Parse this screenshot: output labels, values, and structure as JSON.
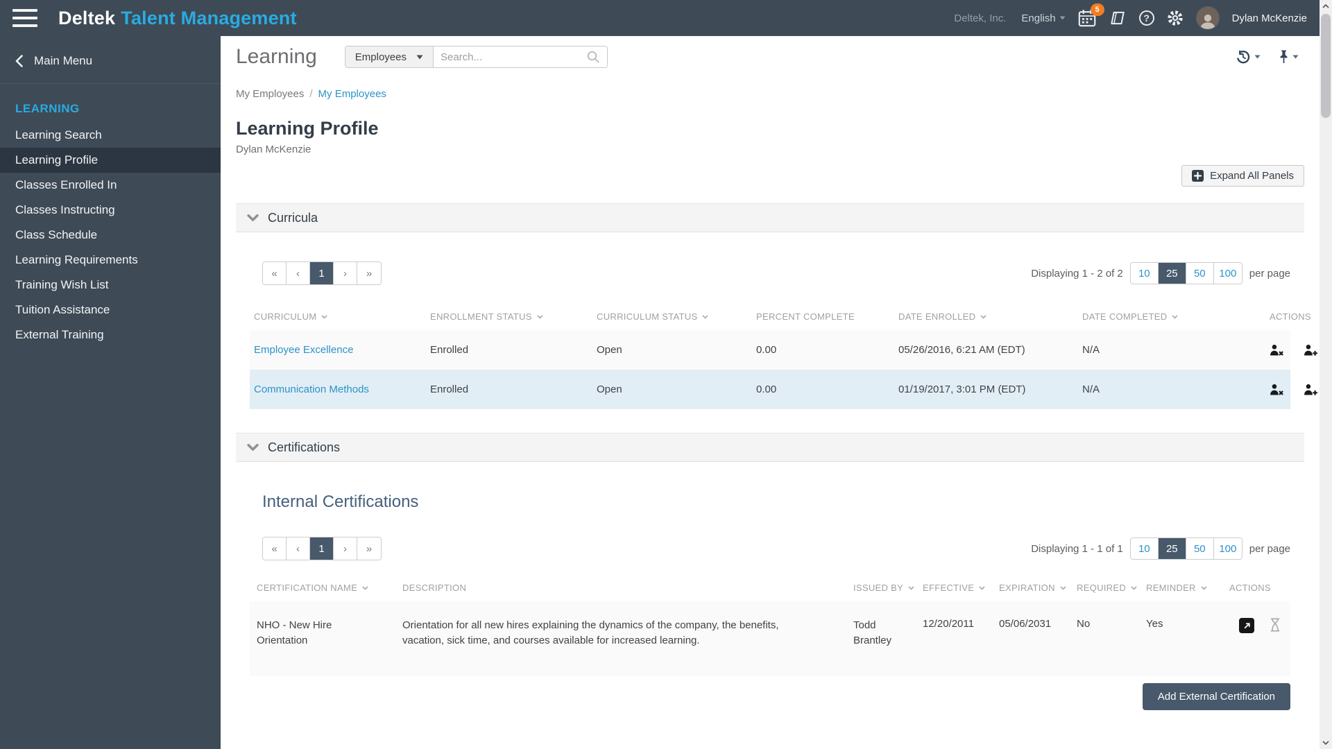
{
  "theme": {
    "topbar_bg": "#3e4a56",
    "accent_cyan": "#29abe2",
    "link_blue": "#2b93c8",
    "active_page_bg": "#47596b",
    "row_highlight": "#e2eef5",
    "badge_orange": "#f47c20"
  },
  "header": {
    "brand_deltek": "Deltek",
    "brand_product": "Talent Management",
    "company": "Deltek, Inc.",
    "language": "English",
    "notification_count": "5",
    "help_glyph": "?",
    "user_name": "Dylan McKenzie"
  },
  "sidebar": {
    "back_label": "Main Menu",
    "section": "LEARNING",
    "items": [
      {
        "label": "Learning Search"
      },
      {
        "label": "Learning Profile"
      },
      {
        "label": "Classes Enrolled In"
      },
      {
        "label": "Classes Instructing"
      },
      {
        "label": "Class Schedule"
      },
      {
        "label": "Learning Requirements"
      },
      {
        "label": "Training Wish List"
      },
      {
        "label": "Tuition Assistance"
      },
      {
        "label": "External Training"
      }
    ]
  },
  "page": {
    "module_title": "Learning",
    "search_scope": "Employees",
    "search_placeholder": "Search...",
    "breadcrumb": [
      "My Employees",
      "My Employees"
    ],
    "breadcrumb_separator": "/",
    "title": "Learning Profile",
    "subtitle": "Dylan McKenzie",
    "expand_all_label": "Expand All Panels"
  },
  "curricula": {
    "panel_title": "Curricula",
    "pagination": {
      "first": "«",
      "prev": "‹",
      "page": "1",
      "next": "›",
      "last": "»",
      "displaying": "Displaying 1 - 2 of 2",
      "sizes": [
        "10",
        "25",
        "50",
        "100"
      ],
      "active_size": "25",
      "per_page": "per page"
    },
    "columns": [
      "CURRICULUM",
      "ENROLLMENT STATUS",
      "CURRICULUM STATUS",
      "PERCENT COMPLETE",
      "DATE ENROLLED",
      "DATE COMPLETED",
      "ACTIONS"
    ],
    "rows": [
      {
        "curriculum": "Employee Excellence",
        "enrollment_status": "Enrolled",
        "curriculum_status": "Open",
        "percent_complete": "0.00",
        "date_enrolled": "05/26/2016, 6:21 AM (EDT)",
        "date_completed": "N/A"
      },
      {
        "curriculum": "Communication Methods",
        "enrollment_status": "Enrolled",
        "curriculum_status": "Open",
        "percent_complete": "0.00",
        "date_enrolled": "01/19/2017, 3:01 PM (EDT)",
        "date_completed": "N/A"
      }
    ]
  },
  "certifications": {
    "panel_title": "Certifications",
    "section_title": "Internal Certifications",
    "pagination": {
      "first": "«",
      "prev": "‹",
      "page": "1",
      "next": "›",
      "last": "»",
      "displaying": "Displaying 1 - 1 of 1",
      "sizes": [
        "10",
        "25",
        "50",
        "100"
      ],
      "active_size": "25",
      "per_page": "per page"
    },
    "columns": [
      "CERTIFICATION NAME",
      "DESCRIPTION",
      "ISSUED BY",
      "EFFECTIVE",
      "EXPIRATION",
      "REQUIRED",
      "REMINDER",
      "ACTIONS"
    ],
    "rows": [
      {
        "name": "NHO - New Hire Orientation",
        "description": "Orientation for all new hires explaining the dynamics of the company, the benefits, vacation, sick time, and courses available for increased learning.",
        "issued_by": "Todd Brantley",
        "effective": "12/20/2011",
        "expiration": "05/06/2031",
        "required": "No",
        "reminder": "Yes"
      }
    ],
    "add_button": "Add External Certification"
  }
}
